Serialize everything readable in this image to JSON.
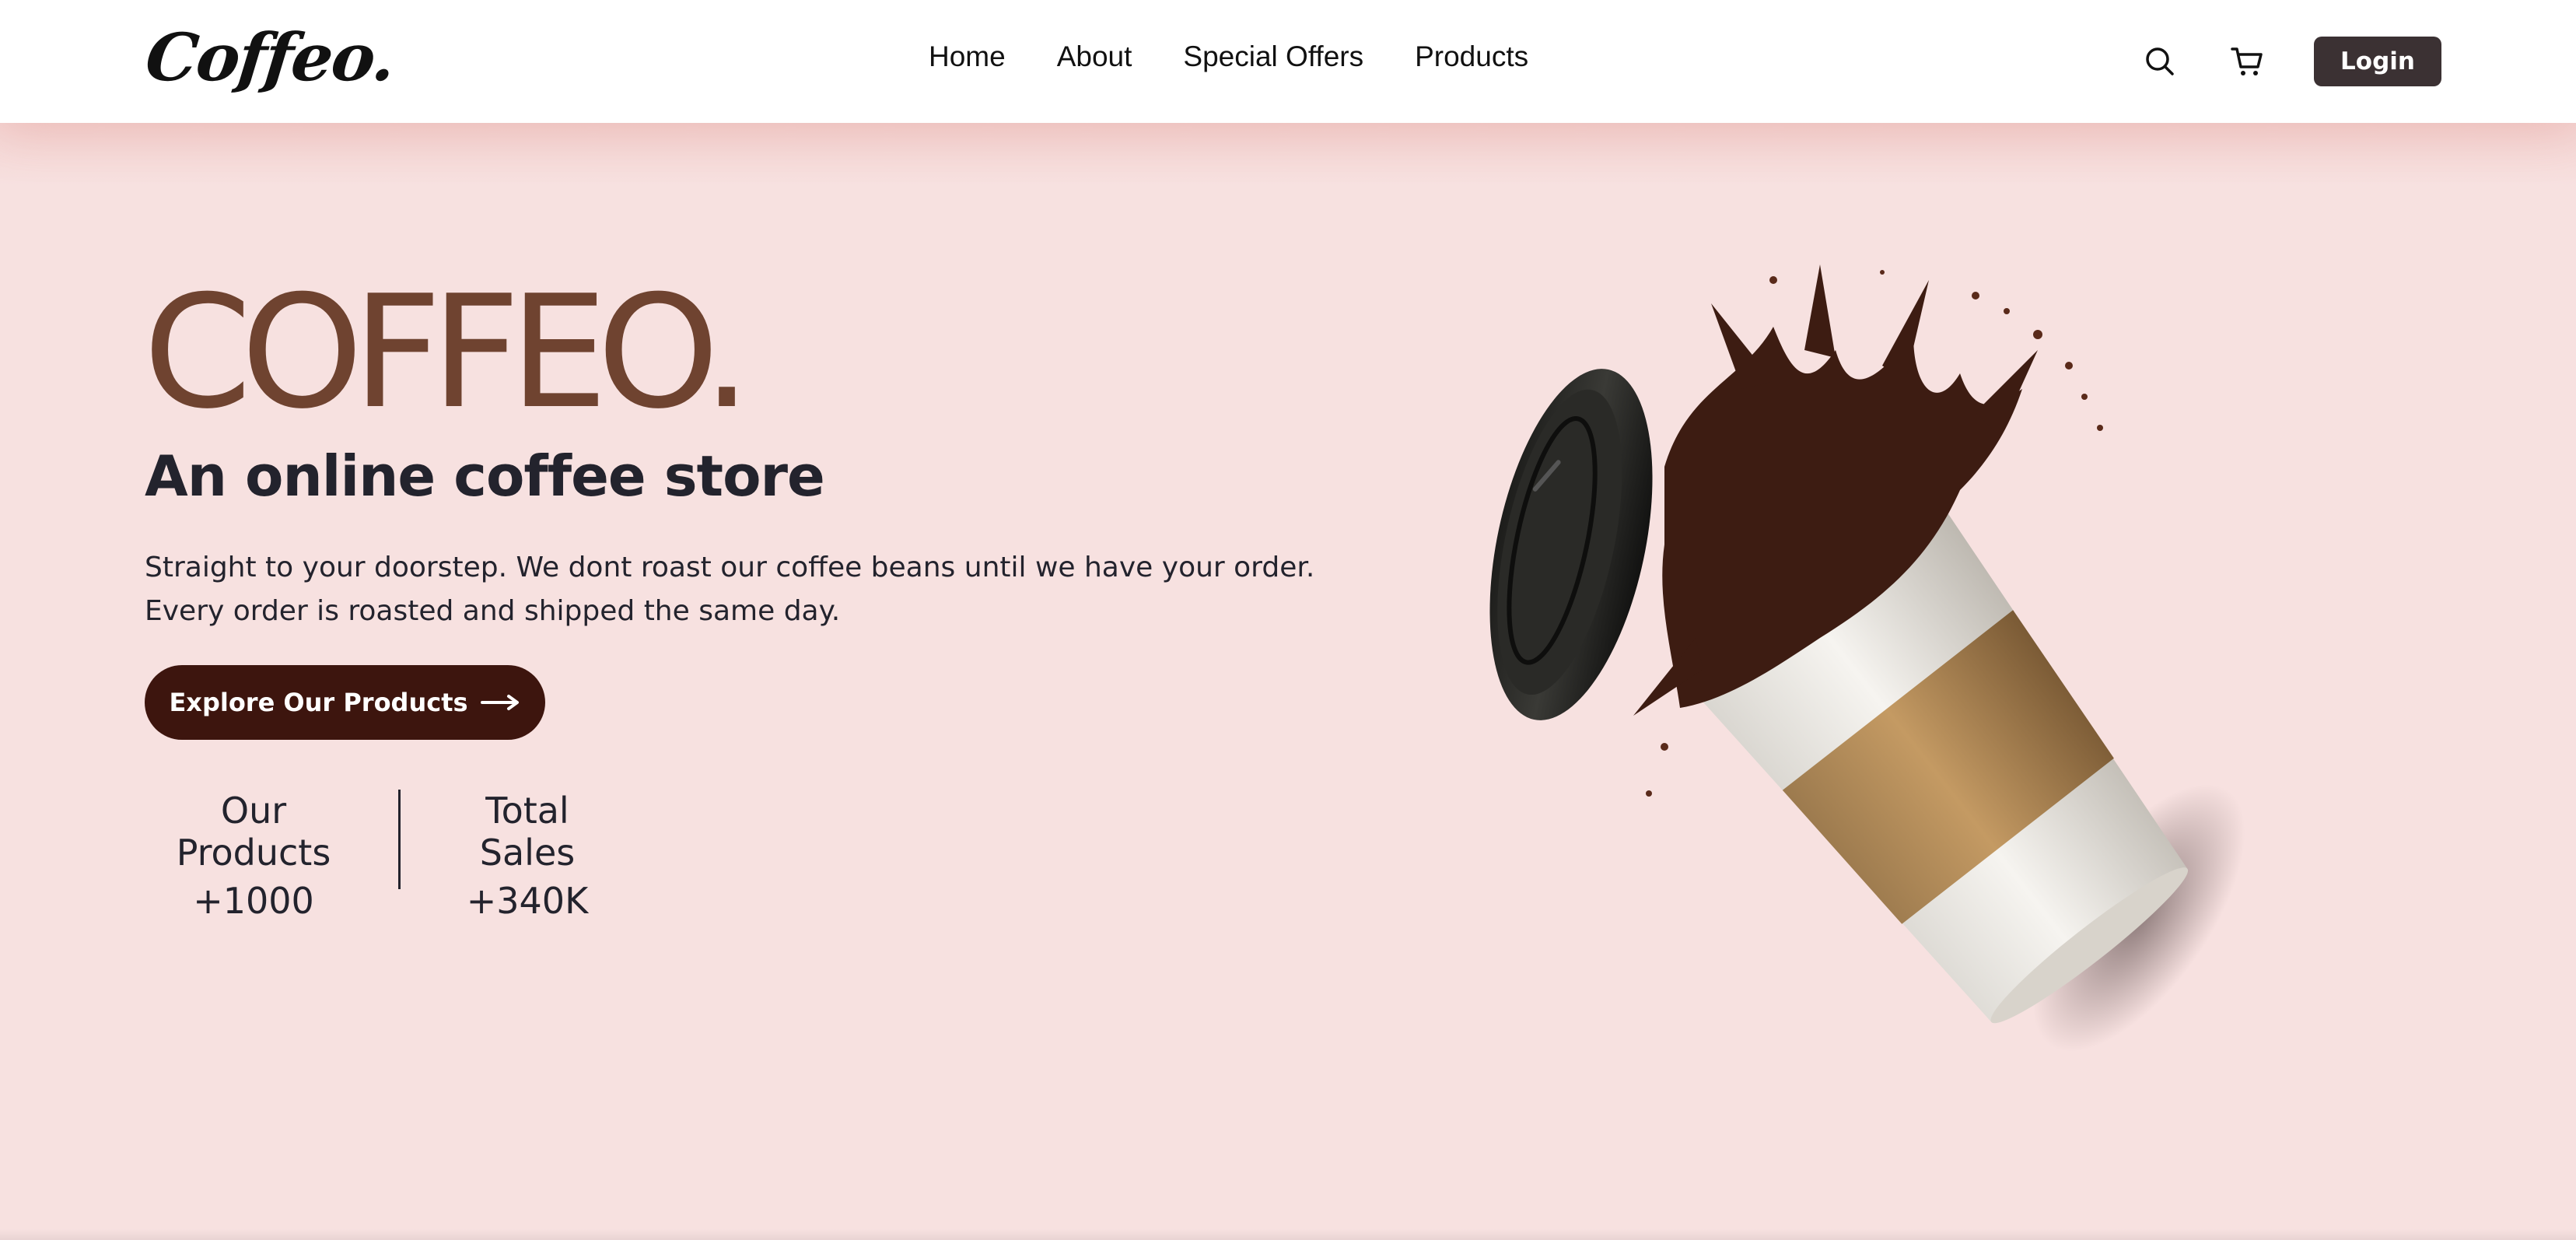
{
  "header": {
    "logo": "Coffeo.",
    "nav": [
      "Home",
      "About",
      "Special Offers",
      "Products"
    ],
    "login_label": "Login",
    "icons": [
      "search-icon",
      "cart-icon"
    ]
  },
  "hero": {
    "brand": "COFFEO.",
    "tagline": "An online coffee store",
    "description_line1": "Straight to your doorstep. We dont roast our coffee beans until we have your order.",
    "description_line2": "Every order is roasted and shipped the same day.",
    "cta_label": "Explore Our Products",
    "cta_icon": "arrow-right-icon"
  },
  "stats": [
    {
      "label": "Our Products",
      "value": "+1000"
    },
    {
      "label": "Total Sales",
      "value": "+340K"
    }
  ],
  "colors": {
    "background": "#f7e1e0",
    "brand_text": "#6f4330",
    "cta_background": "#3d150e",
    "login_background": "#3b3133"
  }
}
